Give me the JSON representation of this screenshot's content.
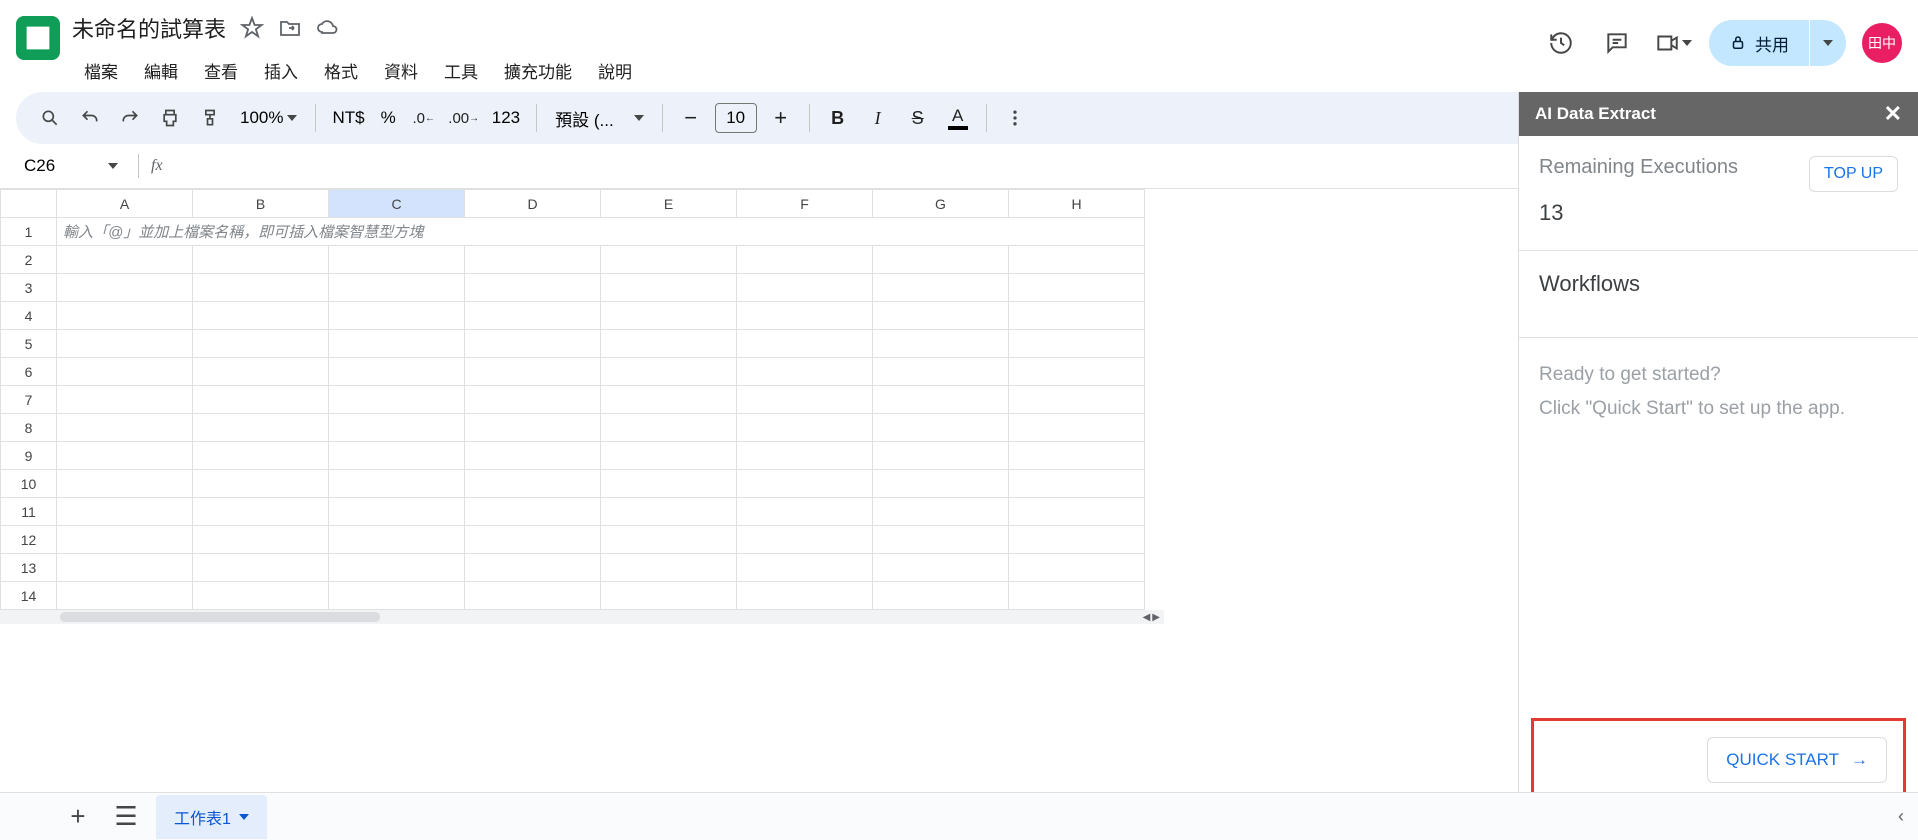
{
  "header": {
    "title": "未命名的試算表",
    "menu": [
      "檔案",
      "編輯",
      "查看",
      "插入",
      "格式",
      "資料",
      "工具",
      "擴充功能",
      "說明"
    ],
    "share_label": "共用",
    "avatar_text": "田中"
  },
  "toolbar": {
    "zoom": "100%",
    "currency": "NT$",
    "percent": "%",
    "point": ".0",
    "double_point": ".00",
    "num_123": "123",
    "font": "預設 (...",
    "font_size": "10"
  },
  "formula_bar": {
    "cell_ref": "C26",
    "fx": "fx"
  },
  "grid": {
    "columns": [
      "A",
      "B",
      "C",
      "D",
      "E",
      "F",
      "G",
      "H"
    ],
    "selected_col": "C",
    "rows": [
      1,
      2,
      3,
      4,
      5,
      6,
      7,
      8,
      9,
      10,
      11,
      12,
      13,
      14
    ],
    "hint": "輸入「@」並加上檔案名稱，即可插入檔案智慧型方塊"
  },
  "sidebar": {
    "title": "AI Data Extract",
    "remaining_label": "Remaining Executions",
    "remaining_value": "13",
    "topup": "TOP UP",
    "workflows": "Workflows",
    "hint1": "Ready to get started?",
    "hint2": "Click \"Quick Start\" to set up the app.",
    "quick_start": "QUICK START"
  },
  "bottom": {
    "sheet1": "工作表1"
  }
}
